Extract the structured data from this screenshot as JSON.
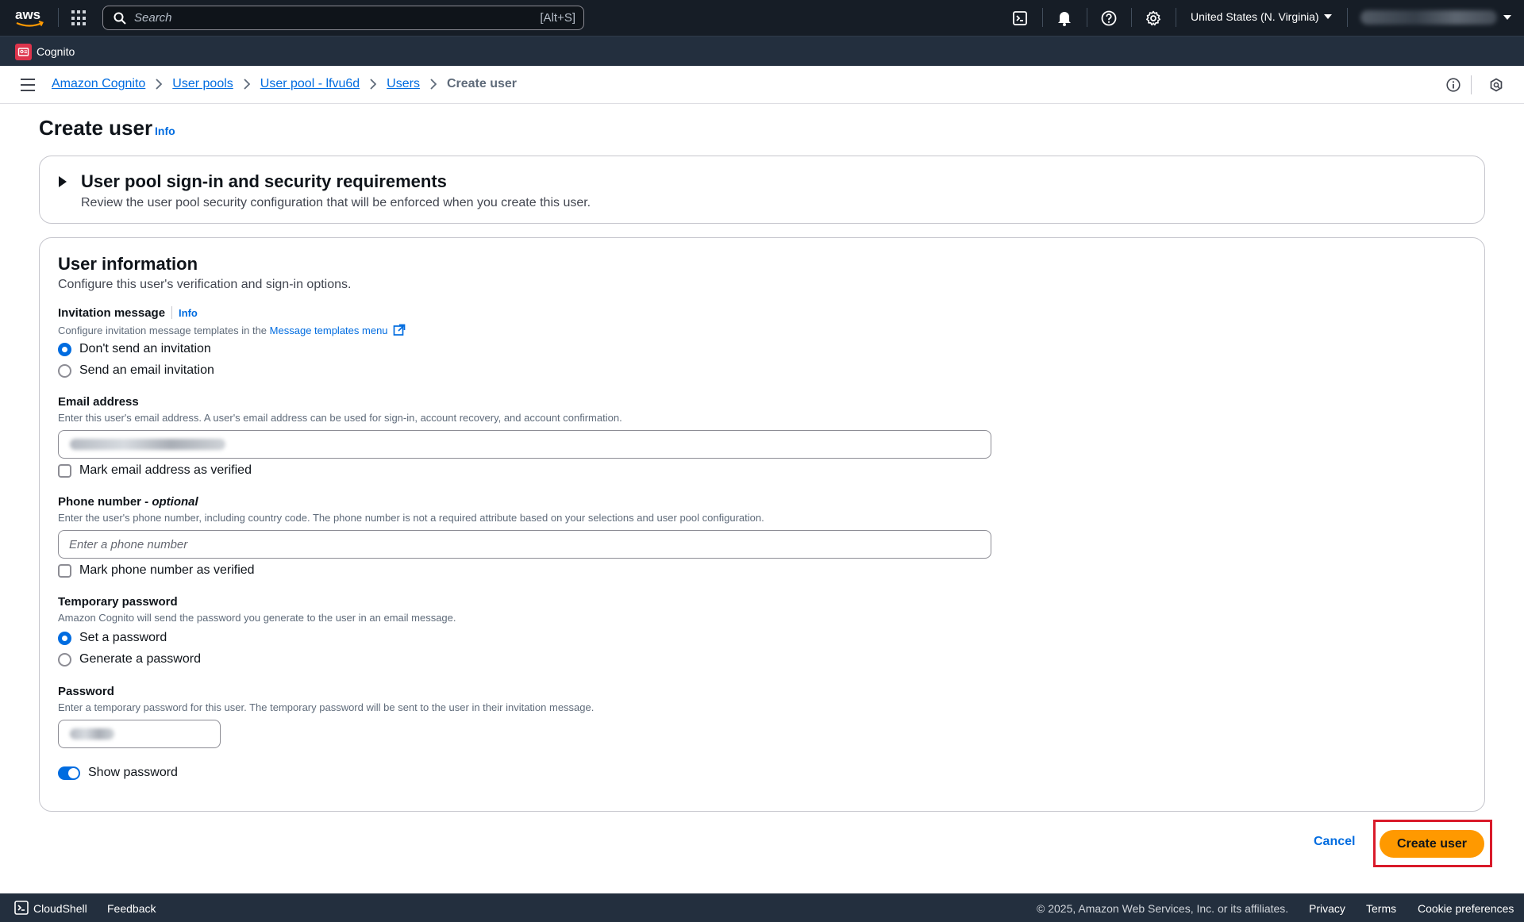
{
  "topnav": {
    "logo": "aws",
    "search_placeholder": "Search",
    "search_shortcut": "[Alt+S]",
    "region": "United States (N. Virginia)",
    "icons": [
      "cloudshell-icon",
      "bell-icon",
      "help-icon",
      "gear-icon"
    ]
  },
  "service_bar": {
    "service_name": "Cognito"
  },
  "breadcrumb": {
    "items": [
      "Amazon Cognito",
      "User pools",
      "User pool - lfvu6d",
      "Users"
    ],
    "current": "Create user"
  },
  "page": {
    "title": "Create user",
    "info": "Info"
  },
  "security_section": {
    "title": "User pool sign-in and security requirements",
    "description": "Review the user pool security configuration that will be enforced when you create this user."
  },
  "user_info": {
    "title": "User information",
    "description": "Configure this user's verification and sign-in options.",
    "invitation": {
      "label": "Invitation message",
      "info": "Info",
      "description_prefix": "Configure invitation message templates in the",
      "link": "Message templates menu",
      "options": [
        "Don't send an invitation",
        "Send an email invitation"
      ],
      "selected": 0
    },
    "email": {
      "label": "Email address",
      "description": "Enter this user's email address. A user's email address can be used for sign-in, account recovery, and account confirmation.",
      "verify_label": "Mark email address as verified"
    },
    "phone": {
      "label": "Phone number -",
      "optional": "optional",
      "description": "Enter the user's phone number, including country code. The phone number is not a required attribute based on your selections and user pool configuration.",
      "placeholder": "Enter a phone number",
      "verify_label": "Mark phone number as verified"
    },
    "temp_password": {
      "label": "Temporary password",
      "description": "Amazon Cognito will send the password you generate to the user in an email message.",
      "options": [
        "Set a password",
        "Generate a password"
      ],
      "selected": 0
    },
    "password": {
      "label": "Password",
      "description": "Enter a temporary password for this user. The temporary password will be sent to the user in their invitation message.",
      "show_password_label": "Show password",
      "show_password": true
    }
  },
  "actions": {
    "cancel": "Cancel",
    "create": "Create user"
  },
  "footer": {
    "cloudshell": "CloudShell",
    "feedback": "Feedback",
    "copyright": "© 2025, Amazon Web Services, Inc. or its affiliates.",
    "privacy": "Privacy",
    "terms": "Terms",
    "cookies": "Cookie preferences"
  },
  "colors": {
    "nav_bg": "#161d26",
    "service_bar_bg": "#232f3e",
    "link": "#006ce0",
    "primary_button": "#ff9900",
    "highlight_outline": "#d91a2a"
  }
}
